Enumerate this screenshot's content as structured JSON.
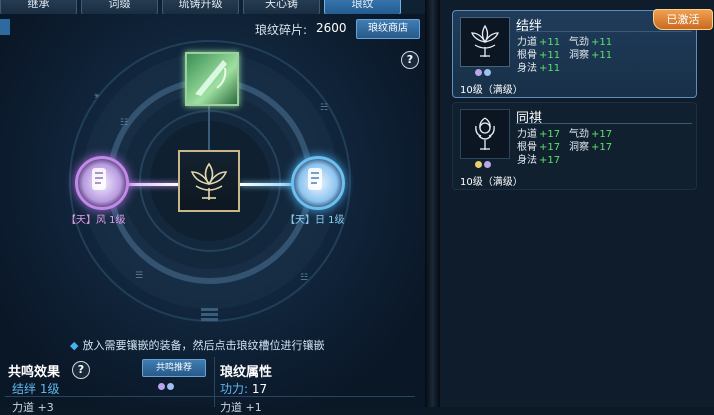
{
  "tabs": [
    "继承",
    "词缀",
    "琉铸升级",
    "天心铸",
    "琅纹"
  ],
  "active_tab_index": 4,
  "fragments": {
    "label": "琅纹碎片:",
    "value": "2600",
    "shop_button": "琅纹商店"
  },
  "help_glyph": "?",
  "gems": {
    "left": {
      "label": "【天】风 1级",
      "color": "#c28ae8"
    },
    "right": {
      "label": "【天】日 1级",
      "color": "#6cc0f0"
    }
  },
  "hint": "放入需要镶嵌的装备，然后点击琅纹槽位进行镶嵌",
  "resonance": {
    "title": "共鸣效果",
    "button": "共鸣推荐",
    "line": "结绊 1级",
    "next_line": "力道 +3"
  },
  "attributes": {
    "title": "琅纹属性",
    "label": "功力:",
    "value": "17",
    "next_line": "力道 +1"
  },
  "cards": [
    {
      "name": "结绊",
      "badge": "已激活",
      "level": "10级（满级）",
      "icon": "lotus-emblem-icon",
      "stats": [
        [
          {
            "label": "力道",
            "val": "+11"
          },
          {
            "label": "气劲",
            "val": "+11"
          }
        ],
        [
          {
            "label": "根骨",
            "val": "+11"
          },
          {
            "label": "洞察",
            "val": "+11"
          }
        ],
        [
          {
            "label": "身法",
            "val": "+11"
          }
        ]
      ],
      "dots": [
        "#b9a6e8",
        "#9cc0f0"
      ]
    },
    {
      "name": "同祺",
      "badge": "",
      "level": "10级（满级）",
      "icon": "flower-emblem-icon",
      "stats": [
        [
          {
            "label": "力道",
            "val": "+17"
          },
          {
            "label": "气劲",
            "val": "+17"
          }
        ],
        [
          {
            "label": "根骨",
            "val": "+17"
          },
          {
            "label": "洞察",
            "val": "+17"
          }
        ],
        [
          {
            "label": "身法",
            "val": "+17"
          }
        ]
      ],
      "dots": [
        "#e8d070",
        "#b9a6e8"
      ]
    }
  ]
}
